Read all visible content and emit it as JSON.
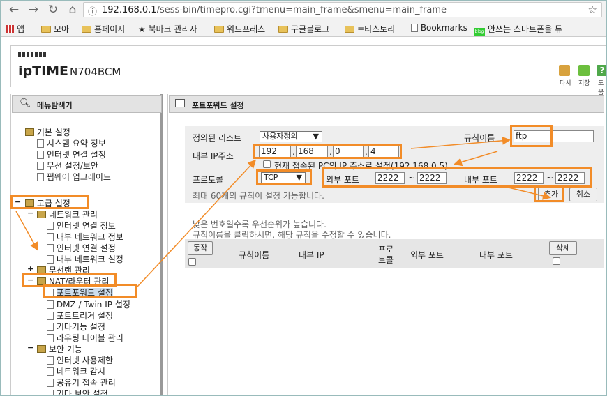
{
  "browser": {
    "url_host": "192.168.0.1",
    "url_path": "/sess-bin/timepro.cgi?tmenu=main_frame&smenu=main_frame",
    "bookmarks": [
      "앱",
      "모아",
      "홈페이지",
      "북마크 관리자",
      "워드프레스",
      "구글블로그",
      "≡티스토리",
      "Bookmarks",
      "안쓰는 스마트폰을 듀"
    ]
  },
  "header": {
    "brand": "ipTIME",
    "model": "N704BCM",
    "tools": [
      "다시",
      "저장",
      "도움"
    ]
  },
  "sidebar": {
    "title": "메뉴탐색기",
    "basic": {
      "label": "기본 설정",
      "items": [
        "시스템 요약 정보",
        "인터넷 연결 설정",
        "무선 설정/보안",
        "펌웨어 업그레이드"
      ]
    },
    "advanced": {
      "label": "고급 설정"
    },
    "network": {
      "label": "네트워크 관리",
      "items": [
        "인터넷 연결 정보",
        "내부 네트워크 정보",
        "인터넷 연결 설정",
        "내부 네트워크 설정"
      ]
    },
    "wireless": {
      "label": "무선랜 관리"
    },
    "nat": {
      "label": "NAT/라우터 관리",
      "items": [
        "포트포워드 설정",
        "DMZ / Twin IP 설정",
        "포트트리거 설정",
        "기타기능 설정",
        "라우팅 테이블 관리"
      ]
    },
    "security": {
      "label": "보안 기능",
      "items": [
        "인터넷 사용제한",
        "네트워크 감시",
        "공유기 접속 관리",
        "기타 보안 설정"
      ]
    }
  },
  "main": {
    "title": "포트포워드 설정",
    "preset_label": "정의된 리스트",
    "preset_value": "사용자정의",
    "rule_name_label": "규칙이름",
    "rule_name_value": "ftp",
    "internal_ip_label": "내부 IP주소",
    "ip": [
      "192",
      "168",
      "0",
      "4"
    ],
    "current_pc_text": "현재 접속된 PC의 IP 주소로 설정(192.168.0.5)",
    "protocol_label": "프로토콜",
    "protocol_value": "TCP",
    "ext_port_label": "외부 포트",
    "ext_port_from": "2222",
    "ext_port_to": "2222",
    "int_port_label": "내부 포트",
    "int_port_from": "2222",
    "int_port_to": "2222",
    "tilde": "~",
    "max_rules_text": "최대 60개의 규칙이 설정 가능합니다.",
    "add_button": "추가",
    "cancel_button": "취소",
    "note1": "낮은 번호일수록 우선순위가 높습니다.",
    "note2": "규칙이름을 클릭하시면, 해당 규칙을 수정할 수 있습니다.",
    "table": {
      "action_button": "동작",
      "col_rule": "규칙이름",
      "col_ip": "내부 IP",
      "col_proto_1": "프로",
      "col_proto_2": "토콜",
      "col_ext": "외부 포트",
      "col_int": "내부 포트",
      "delete_button": "삭제"
    }
  },
  "colors": {
    "highlight": "#f28c28",
    "pane_header": "#e3e3e3",
    "form_bg": "#eeeeee"
  }
}
